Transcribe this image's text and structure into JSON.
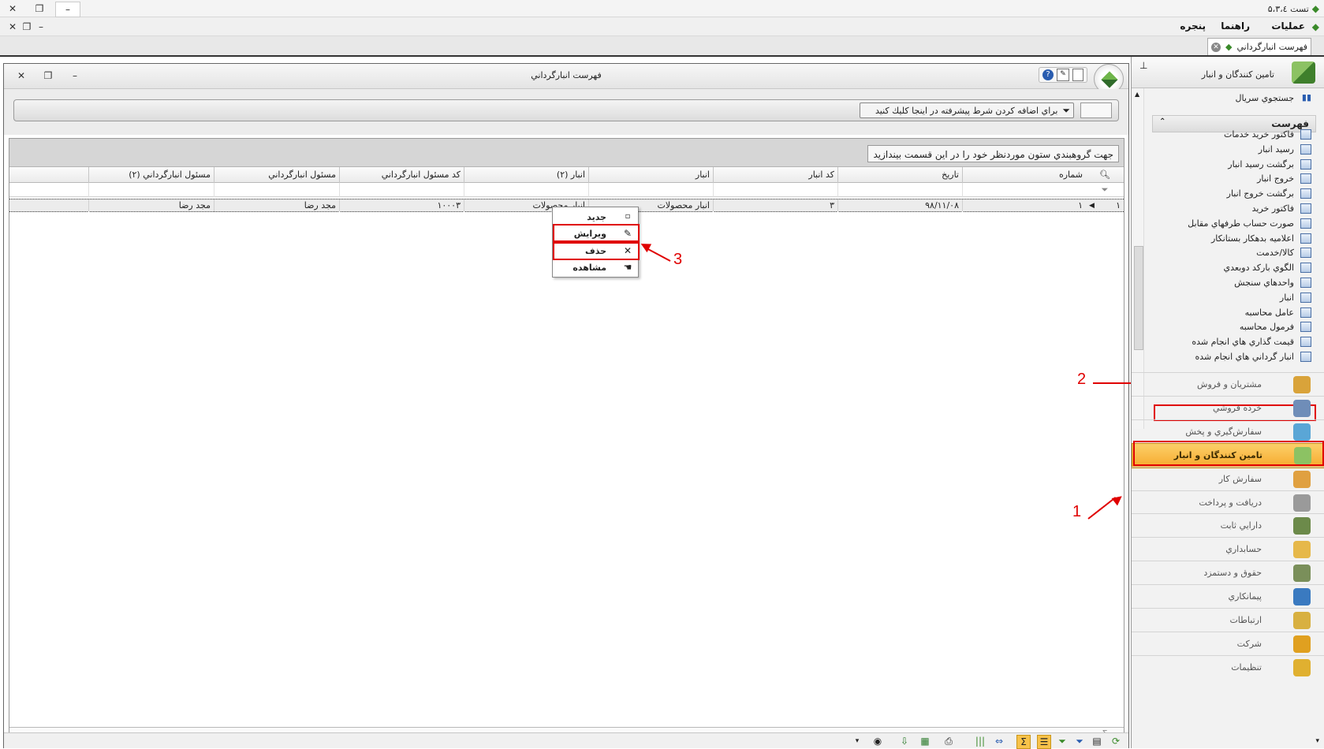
{
  "app": {
    "title": "تست ۵،۳،٤",
    "window_controls": [
      "_",
      "❐",
      "✕"
    ]
  },
  "menu": {
    "items": [
      "عمليات",
      "راهنما",
      "پنجره"
    ],
    "mdi_controls": [
      "_",
      "❐",
      "✕"
    ]
  },
  "doc_tab": {
    "label": "فهرست انبارگرداني"
  },
  "document": {
    "title": "فهرست انبارگرداني",
    "filter_button": "براي اضافه كردن شرط پيشرفته در اينجا كليك كنيد",
    "group_hint": "جهت گروهبندي ستون موردنظر خود را در اين قسمت بيندازيد",
    "columns": [
      "شماره",
      "تاريخ",
      "كد انبار",
      "انبار",
      "انبار (۲)",
      "كد مسئول انبارگرداني",
      "مسئول انبارگرداني",
      "مسئول انبارگرداني (۲)"
    ],
    "rows": [
      {
        "index": "۱",
        "cells": [
          "۱",
          "۹۸/۱۱/۰۸",
          "۳",
          "انبار محصولات",
          "انبار محصولات",
          "۱۰۰۰۳",
          "مجد رضا",
          "مجد رضا"
        ]
      }
    ],
    "footer_symbol": "Σ"
  },
  "context_menu": {
    "items": [
      {
        "label": "جديد",
        "icon": "new-doc-icon"
      },
      {
        "label": "ويرايش",
        "icon": "edit-pencil-icon"
      },
      {
        "label": "حذف",
        "icon": "delete-x-icon"
      },
      {
        "label": "مشاهده",
        "icon": "view-hand-icon"
      }
    ]
  },
  "annotations": {
    "a1": "1",
    "a2": "2",
    "a3": "3"
  },
  "nav": {
    "header": "تامين كنندگان و انبار",
    "search": "جستجوي سريال",
    "list_title": "فهرست",
    "list_items": [
      "فاكتور خريد خدمات",
      "رسيد انبار",
      "برگشت رسيد انبار",
      "خروج انبار",
      "برگشت خروج انبار",
      "فاكتور خريد",
      "صورت حساب طرفهاي مقابل",
      "اعلاميه بدهكار بستانكار",
      "كالا/خدمت",
      "الگوي باركد دوبعدي",
      "واحدهاي سنجش",
      "انبار",
      "عامل محاسبه",
      "فرمول محاسبه",
      "قيمت گذاري هاي انجام شده",
      "انبار گرداني هاي انجام شده"
    ],
    "modules": [
      "مشتريان و فروش",
      "خرده فروشي",
      "سفارش‌گيري و پخش",
      "تامين كنندگان و انبار",
      "سفارش كار",
      "دريافت و پرداخت",
      "دارايي ثابت",
      "حسابداري",
      "حقوق و دستمزد",
      "پيمانكاري",
      "ارتباطات",
      "شركت",
      "تنظيمات"
    ],
    "active_module": "تامين كنندگان و انبار"
  },
  "colors": {
    "highlight": "#e00000",
    "active_module_bg": "#f7a92c"
  }
}
